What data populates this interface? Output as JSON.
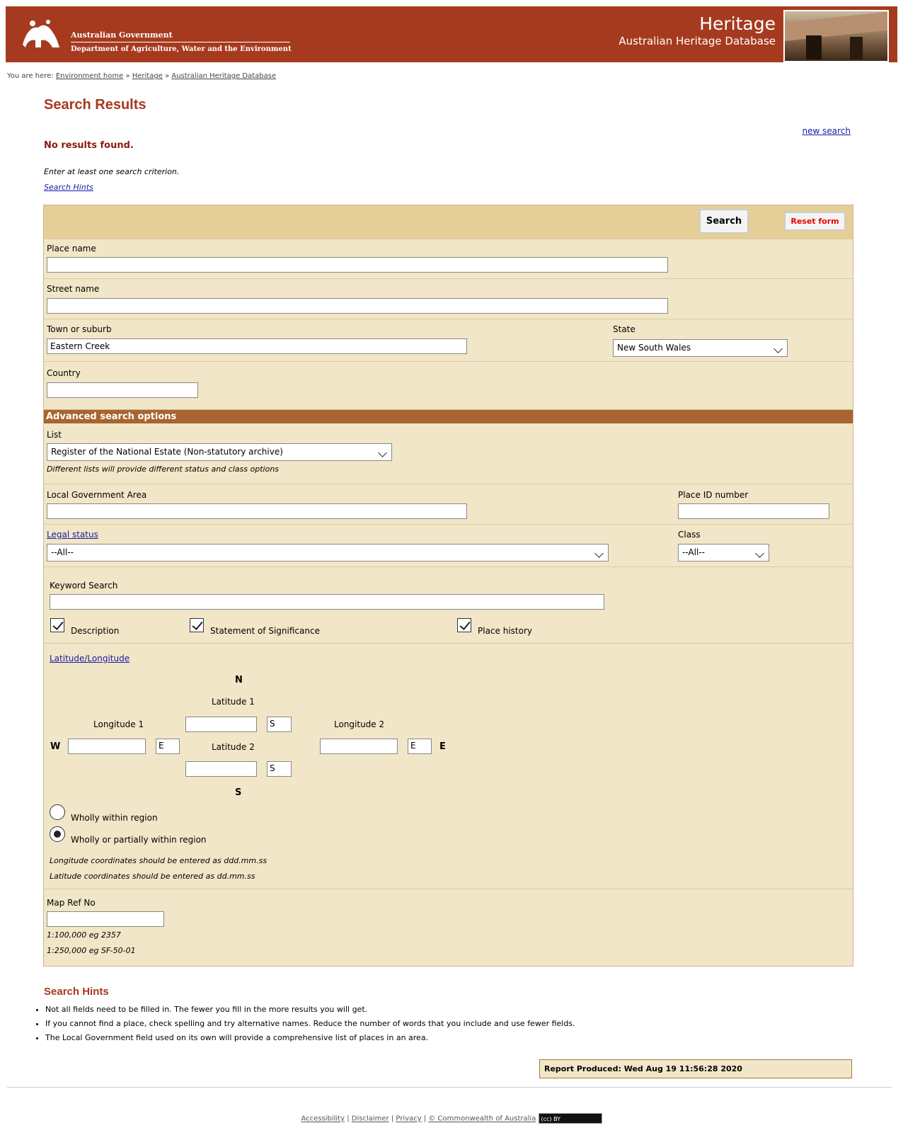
{
  "header": {
    "gov_line1": "Australian Government",
    "gov_line2": "Department of Agriculture, Water and the Environment",
    "brand_title": "Heritage",
    "brand_sub": "Australian Heritage Database"
  },
  "breadcrumb": {
    "prefix": "You are here:",
    "items": [
      "Environment home",
      "Heritage",
      "Australian Heritage Database"
    ],
    "sep": "»"
  },
  "page": {
    "title": "Search Results",
    "new_search": "new search",
    "no_results": "No results found.",
    "criterion": "Enter at least one search criterion.",
    "hints_link": "Search Hints"
  },
  "form": {
    "search_button": "Search",
    "reset_button": "Reset form",
    "place_name_label": "Place name",
    "place_name_value": "",
    "street_name_label": "Street name",
    "street_name_value": "",
    "town_label": "Town or suburb",
    "town_value": "Eastern Creek",
    "state_label": "State",
    "state_value": "New South Wales",
    "country_label": "Country",
    "country_value": ""
  },
  "advanced": {
    "heading": "Advanced search options",
    "list_label": "List",
    "list_value": "Register of the National Estate (Non-statutory archive)",
    "list_note": "Different lists will provide different status and class options",
    "lga_label": "Local Government Area",
    "place_id_label": "Place ID number",
    "legal_status_label": "Legal status",
    "legal_status_value": "--All--",
    "class_label": "Class",
    "class_value": "--All--",
    "keyword_label": "Keyword Search",
    "checkbox_description": "Description",
    "checkbox_significance": "Statement of Significance",
    "checkbox_history": "Place history",
    "latlong_link": "Latitude/Longitude",
    "north": "N",
    "south": "S",
    "west": "W",
    "east": "E",
    "lat1_label": "Latitude 1",
    "lat2_label": "Latitude 2",
    "long1_label": "Longitude 1",
    "long2_label": "Longitude 2",
    "lat1_hemi": "S",
    "lat2_hemi": "S",
    "long1_hemi": "E",
    "long2_hemi": "E",
    "radio_wholly": "Wholly within region",
    "radio_partial": "Wholly or partially within region",
    "long_note": "Longitude coordinates should be entered as ddd.mm.ss",
    "lat_note": "Latitude coordinates should be entered as dd.mm.ss",
    "mapref_label": "Map Ref No",
    "mapref_eg1": "1:100,000 eg 2357",
    "mapref_eg2": "1:250,000 eg SF-50-01"
  },
  "search_hints": {
    "title": "Search Hints",
    "items": [
      "Not all fields need to be filled in. The fewer you fill in the more results you will get.",
      "If you cannot find a place, check spelling and try alternative names. Reduce the number of words that you include and use fewer fields.",
      "The Local Government field used on its own will provide a comprehensive list of places in an area."
    ]
  },
  "report": "Report Produced: Wed Aug 19 11:56:28 2020",
  "footer": {
    "links": [
      "Accessibility",
      "Disclaimer",
      "Privacy",
      "© Commonwealth of Australia"
    ],
    "sep": "|",
    "cc_badge": "(cc) BY"
  }
}
